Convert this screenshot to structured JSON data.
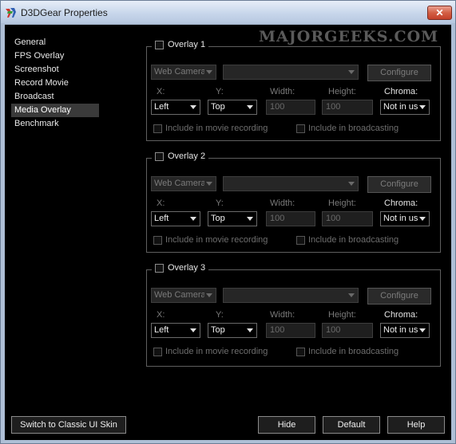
{
  "window": {
    "title": "D3DGear Properties",
    "close_glyph": "✕"
  },
  "watermark": "MAJORGEEKS.COM",
  "sidebar": {
    "items": [
      {
        "label": "General"
      },
      {
        "label": "FPS Overlay"
      },
      {
        "label": "Screenshot"
      },
      {
        "label": "Record Movie"
      },
      {
        "label": "Broadcast"
      },
      {
        "label": "Media Overlay",
        "active": true
      },
      {
        "label": "Benchmark"
      }
    ]
  },
  "overlays": [
    {
      "title": "Overlay 1",
      "source": "Web Camera",
      "device": "",
      "configure_label": "Configure",
      "x_label": "X:",
      "y_label": "Y:",
      "width_label": "Width:",
      "height_label": "Height:",
      "chroma_label": "Chroma:",
      "x_value": "Left",
      "y_value": "Top",
      "width_value": "100",
      "height_value": "100",
      "chroma_value": "Not in use",
      "include_movie_label": "Include in movie recording",
      "include_broadcast_label": "Include in broadcasting"
    },
    {
      "title": "Overlay 2",
      "source": "Web Camera",
      "device": "",
      "configure_label": "Configure",
      "x_label": "X:",
      "y_label": "Y:",
      "width_label": "Width:",
      "height_label": "Height:",
      "chroma_label": "Chroma:",
      "x_value": "Left",
      "y_value": "Top",
      "width_value": "100",
      "height_value": "100",
      "chroma_value": "Not in use",
      "include_movie_label": "Include in movie recording",
      "include_broadcast_label": "Include in broadcasting"
    },
    {
      "title": "Overlay 3",
      "source": "Web Camera",
      "device": "",
      "configure_label": "Configure",
      "x_label": "X:",
      "y_label": "Y:",
      "width_label": "Width:",
      "height_label": "Height:",
      "chroma_label": "Chroma:",
      "x_value": "Left",
      "y_value": "Top",
      "width_value": "100",
      "height_value": "100",
      "chroma_value": "Not in use",
      "include_movie_label": "Include in movie recording",
      "include_broadcast_label": "Include in broadcasting"
    }
  ],
  "footer": {
    "classic_label": "Switch to Classic UI Skin",
    "hide_label": "Hide",
    "default_label": "Default",
    "help_label": "Help"
  },
  "colors": {
    "background": "#000000",
    "accent_close": "#c4412a",
    "titlebar": "#c6d5ea"
  }
}
